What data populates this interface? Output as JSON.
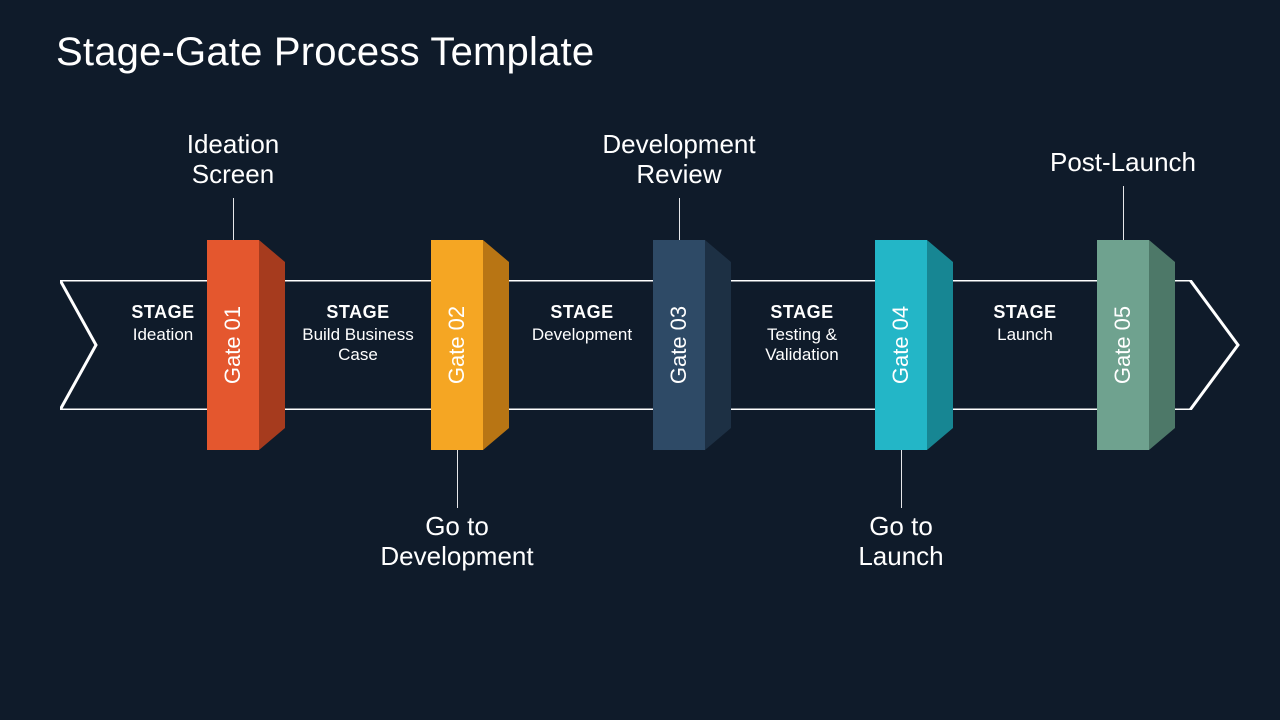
{
  "title": "Stage-Gate Process Template",
  "colors": {
    "bg": "#0f1b2a",
    "stroke": "#ffffff",
    "gate1": "#e4572e",
    "gate1_shade": "#a63b1e",
    "gate2": "#f5a623",
    "gate2_shade": "#b87514",
    "gate3": "#2e4a66",
    "gate3_shade": "#1d3044",
    "gate4": "#23b6c7",
    "gate4_shade": "#178693",
    "gate5": "#6fa28f",
    "gate5_shade": "#4d7868"
  },
  "stage_label": "STAGE",
  "stages": [
    {
      "name": "Ideation"
    },
    {
      "name": "Build Business Case"
    },
    {
      "name": "Development"
    },
    {
      "name": "Testing & Validation"
    },
    {
      "name": "Launch"
    }
  ],
  "gates": [
    {
      "label": "Gate 01",
      "callout": "Ideation Screen",
      "callout_pos": "top"
    },
    {
      "label": "Gate 02",
      "callout": "Go to Development",
      "callout_pos": "bottom"
    },
    {
      "label": "Gate 03",
      "callout": "Development Review",
      "callout_pos": "top"
    },
    {
      "label": "Gate 04",
      "callout": "Go to Launch",
      "callout_pos": "bottom"
    },
    {
      "label": "Gate 05",
      "callout": "Post-Launch",
      "callout_pos": "top"
    }
  ]
}
